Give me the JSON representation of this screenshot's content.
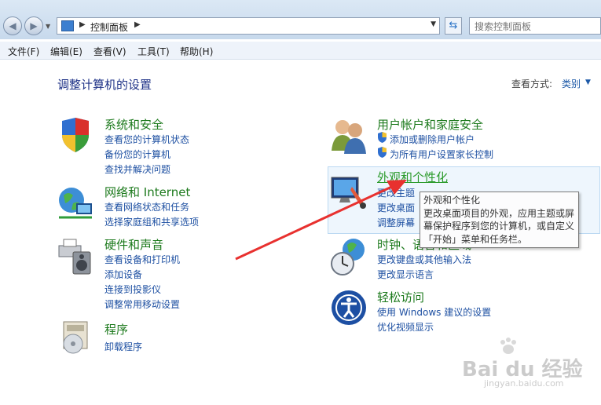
{
  "address_bar": {
    "path": [
      "控制面板"
    ]
  },
  "search": {
    "placeholder": "搜索控制面板"
  },
  "menu": [
    "文件(F)",
    "编辑(E)",
    "查看(V)",
    "工具(T)",
    "帮助(H)"
  ],
  "main": {
    "title": "调整计算机的设置",
    "view_label": "查看方式:",
    "view_value": "类别"
  },
  "categories": [
    {
      "title": "系统和安全",
      "links": [
        "查看您的计算机状态",
        "备份您的计算机",
        "查找并解决问题"
      ]
    },
    {
      "title": "网络和 Internet",
      "links": [
        "查看网络状态和任务",
        "选择家庭组和共享选项"
      ]
    },
    {
      "title": "硬件和声音",
      "links": [
        "查看设备和打印机",
        "添加设备",
        "连接到投影仪",
        "调整常用移动设置"
      ]
    },
    {
      "title": "程序",
      "links": [
        "卸载程序"
      ]
    },
    {
      "title": "用户帐户和家庭安全",
      "links": [
        "添加或删除用户帐户",
        "为所有用户设置家长控制"
      ]
    },
    {
      "title": "外观和个性化",
      "links": [
        "更改主题",
        "更改桌面",
        "调整屏幕"
      ]
    },
    {
      "title": "时钟、语言和区域",
      "links": [
        "更改键盘或其他输入法",
        "更改显示语言"
      ]
    },
    {
      "title": "轻松访问",
      "links": [
        "使用 Windows 建议的设置",
        "优化视频显示"
      ]
    }
  ],
  "tooltip": {
    "title": "外观和个性化",
    "body": "更改桌面项目的外观，应用主题或屏幕保护程序到您的计算机，或自定义「开始」菜单和任务栏。"
  },
  "watermark": {
    "brand": "Bai du 经验",
    "url": "jingyan.baidu.com"
  },
  "colors": {
    "category_title": "#1d7a1d",
    "link": "#1e50a2",
    "page_title": "#1e3287",
    "arrow": "#e8312f"
  }
}
